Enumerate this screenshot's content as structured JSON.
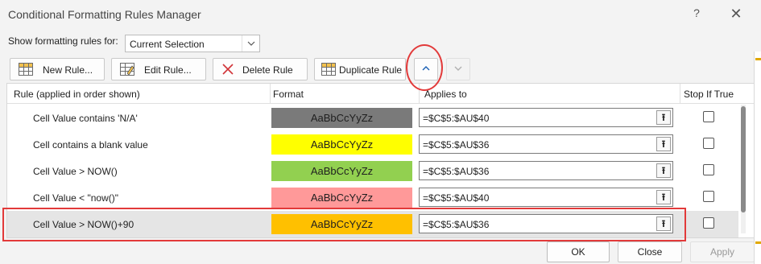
{
  "window": {
    "title": "Conditional Formatting Rules Manager",
    "help_glyph": "?",
    "close_glyph": "✕"
  },
  "show_rules": {
    "label": "Show formatting rules for:",
    "selected": "Current Selection"
  },
  "toolbar": {
    "new_rule": "New Rule...",
    "edit_rule": "Edit Rule...",
    "delete_rule": "Delete Rule",
    "duplicate_rule": "Duplicate Rule",
    "move_up_icon": "chevron-up-icon",
    "move_down_icon": "chevron-down-icon"
  },
  "columns": {
    "rule": "Rule (applied in order shown)",
    "format": "Format",
    "applies_to": "Applies to",
    "stop_if_true": "Stop If True"
  },
  "rules": [
    {
      "rule": "Cell Value contains 'N/A'",
      "preview": "AaBbCcYyZz",
      "fill": "#7a7a7a",
      "text_color": "#1f1f1f",
      "applies_to": "=$C$5:$AU$40",
      "stop_if_true": false
    },
    {
      "rule": "Cell contains a blank value",
      "preview": "AaBbCcYyZz",
      "fill": "#ffff00",
      "text_color": "#1f1f1f",
      "applies_to": "=$C$5:$AU$36",
      "stop_if_true": false
    },
    {
      "rule": "Cell Value > NOW()",
      "preview": "AaBbCcYyZz",
      "fill": "#92d050",
      "text_color": "#1f1f1f",
      "applies_to": "=$C$5:$AU$36",
      "stop_if_true": false
    },
    {
      "rule": "Cell Value < \"now()\"",
      "preview": "AaBbCcYyZz",
      "fill": "#ff9999",
      "text_color": "#1f1f1f",
      "applies_to": "=$C$5:$AU$40",
      "stop_if_true": false
    },
    {
      "rule": "Cell Value > NOW()+90",
      "preview": "AaBbCcYyZz",
      "fill": "#ffc000",
      "text_color": "#1f1f1f",
      "applies_to": "=$C$5:$AU$36",
      "stop_if_true": false,
      "selected": true
    }
  ],
  "footer": {
    "ok": "OK",
    "close": "Close",
    "apply": "Apply"
  },
  "colors": {
    "annotation_red": "#e23a3a",
    "selected_row": "#e5e5e5"
  }
}
